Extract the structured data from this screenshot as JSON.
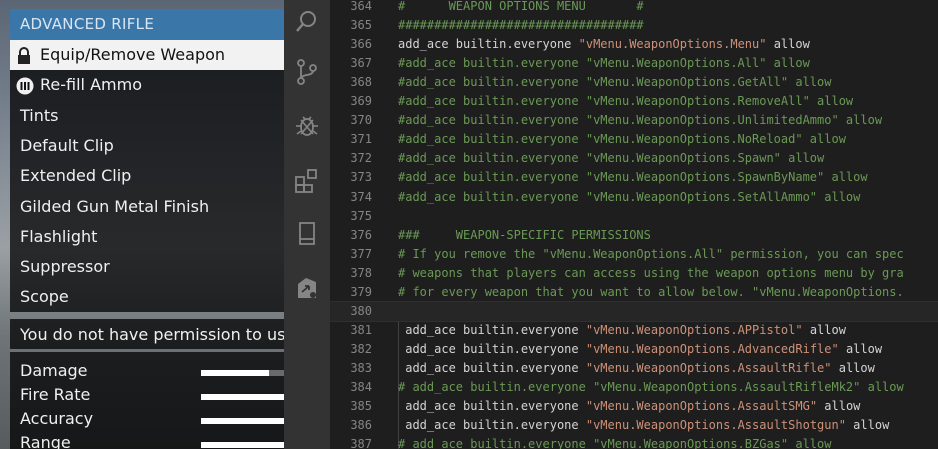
{
  "game_menu": {
    "header": "ADVANCED RIFLE",
    "items": [
      {
        "label": "Equip/Remove Weapon",
        "icon": "lock-icon",
        "selected": true
      },
      {
        "label": "Re-fill Ammo",
        "icon": "ammo-icon",
        "selected": false
      },
      {
        "label": "Tints",
        "selected": false
      },
      {
        "label": "Default Clip",
        "selected": false
      },
      {
        "label": "Extended Clip",
        "selected": false
      },
      {
        "label": "Gilded Gun Metal Finish",
        "selected": false
      },
      {
        "label": "Flashlight",
        "selected": false
      },
      {
        "label": "Suppressor",
        "selected": false
      },
      {
        "label": "Scope",
        "selected": false
      }
    ],
    "description": "You do not have permission to use",
    "stats": [
      {
        "label": "Damage",
        "value": 0.82
      },
      {
        "label": "Fire Rate",
        "value": 1.0
      },
      {
        "label": "Accuracy",
        "value": 1.0
      },
      {
        "label": "Range",
        "value": 1.0
      }
    ]
  },
  "activity_bar": {
    "icons": [
      "search-icon",
      "source-control-icon",
      "debug-icon",
      "extensions-icon",
      "bookmark-icon",
      "remote-icon"
    ]
  },
  "editor": {
    "lines": [
      {
        "n": "364",
        "indent": "",
        "tokens": [
          {
            "t": "#      WEAPON OPTIONS MENU       #",
            "c": "cm"
          }
        ]
      },
      {
        "n": "365",
        "indent": "",
        "tokens": [
          {
            "t": "##################################",
            "c": "cm"
          }
        ]
      },
      {
        "n": "366",
        "indent": "",
        "tokens": [
          {
            "t": "add_ace builtin.everyone ",
            "c": ""
          },
          {
            "t": "\"vMenu.WeaponOptions.Menu\"",
            "c": "st"
          },
          {
            "t": " allow",
            "c": ""
          }
        ]
      },
      {
        "n": "367",
        "indent": "",
        "tokens": [
          {
            "t": "#add_ace builtin.everyone \"vMenu.WeaponOptions.All\" allow",
            "c": "cm"
          }
        ]
      },
      {
        "n": "368",
        "indent": "",
        "tokens": [
          {
            "t": "#add_ace builtin.everyone \"vMenu.WeaponOptions.GetAll\" allow",
            "c": "cm"
          }
        ]
      },
      {
        "n": "369",
        "indent": "",
        "tokens": [
          {
            "t": "#add_ace builtin.everyone \"vMenu.WeaponOptions.RemoveAll\" allow",
            "c": "cm"
          }
        ]
      },
      {
        "n": "370",
        "indent": "",
        "tokens": [
          {
            "t": "#add_ace builtin.everyone \"vMenu.WeaponOptions.UnlimitedAmmo\" allow",
            "c": "cm"
          }
        ]
      },
      {
        "n": "371",
        "indent": "",
        "tokens": [
          {
            "t": "#add_ace builtin.everyone \"vMenu.WeaponOptions.NoReload\" allow",
            "c": "cm"
          }
        ]
      },
      {
        "n": "372",
        "indent": "",
        "tokens": [
          {
            "t": "#add_ace builtin.everyone \"vMenu.WeaponOptions.Spawn\" allow",
            "c": "cm"
          }
        ]
      },
      {
        "n": "373",
        "indent": "",
        "tokens": [
          {
            "t": "#add_ace builtin.everyone \"vMenu.WeaponOptions.SpawnByName\" allow",
            "c": "cm"
          }
        ]
      },
      {
        "n": "374",
        "indent": "",
        "tokens": [
          {
            "t": "#add_ace builtin.everyone \"vMenu.WeaponOptions.SetAllAmmo\" allow",
            "c": "cm"
          }
        ]
      },
      {
        "n": "375",
        "indent": "",
        "tokens": []
      },
      {
        "n": "376",
        "indent": "",
        "tokens": [
          {
            "t": "###     WEAPON-SPECIFIC PERMISSIONS",
            "c": "cm"
          }
        ]
      },
      {
        "n": "377",
        "indent": "",
        "tokens": [
          {
            "t": "# If you remove the \"vMenu.WeaponOptions.All\" permission, you can spec",
            "c": "cm"
          }
        ]
      },
      {
        "n": "378",
        "indent": "",
        "tokens": [
          {
            "t": "# weapons that players can access using the weapon options menu by gra",
            "c": "cm"
          }
        ]
      },
      {
        "n": "379",
        "indent": "",
        "tokens": [
          {
            "t": "# for every weapon that you want to allow below. \"vMenu.WeaponOptions.",
            "c": "cm"
          }
        ]
      },
      {
        "n": "380",
        "indent": "",
        "tokens": [],
        "highlight": true
      },
      {
        "n": "381",
        "indent": " ",
        "tokens": [
          {
            "t": "add_ace builtin.everyone ",
            "c": ""
          },
          {
            "t": "\"vMenu.WeaponOptions.APPistol\"",
            "c": "st"
          },
          {
            "t": " allow",
            "c": ""
          }
        ]
      },
      {
        "n": "382",
        "indent": " ",
        "tokens": [
          {
            "t": "add_ace builtin.everyone ",
            "c": ""
          },
          {
            "t": "\"vMenu.WeaponOptions.AdvancedRifle\"",
            "c": "st"
          },
          {
            "t": " allow",
            "c": ""
          }
        ]
      },
      {
        "n": "383",
        "indent": " ",
        "tokens": [
          {
            "t": "add_ace builtin.everyone ",
            "c": ""
          },
          {
            "t": "\"vMenu.WeaponOptions.AssaultRifle\"",
            "c": "st"
          },
          {
            "t": " allow",
            "c": ""
          }
        ]
      },
      {
        "n": "384",
        "indent": "",
        "tokens": [
          {
            "t": "# add_ace builtin.everyone \"vMenu.WeaponOptions.AssaultRifleMk2\" allow",
            "c": "cm"
          }
        ]
      },
      {
        "n": "385",
        "indent": " ",
        "tokens": [
          {
            "t": "add_ace builtin.everyone ",
            "c": ""
          },
          {
            "t": "\"vMenu.WeaponOptions.AssaultSMG\"",
            "c": "st"
          },
          {
            "t": " allow",
            "c": ""
          }
        ]
      },
      {
        "n": "386",
        "indent": " ",
        "tokens": [
          {
            "t": "add_ace builtin.everyone ",
            "c": ""
          },
          {
            "t": "\"vMenu.WeaponOptions.AssaultShotgun\"",
            "c": "st"
          },
          {
            "t": " allow",
            "c": ""
          }
        ]
      },
      {
        "n": "387",
        "indent": "",
        "tokens": [
          {
            "t": "# add_ace builtin.everyone \"vMenu.WeaponOptions.BZGas\" allow",
            "c": "cm"
          }
        ]
      }
    ]
  },
  "colors": {
    "menu_header": "#3a76a8",
    "comment": "#6a9955",
    "string": "#ce9178",
    "code": "#d4d4d4",
    "line_number": "#858585"
  }
}
